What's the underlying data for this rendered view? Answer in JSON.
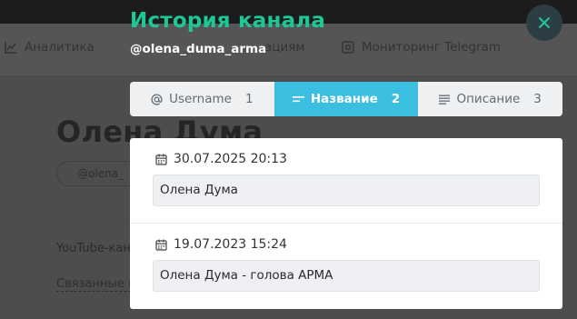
{
  "background": {
    "nav": [
      {
        "label": "Аналитика",
        "icon": "chart-icon"
      },
      {
        "label": "ациям",
        "icon": ""
      },
      {
        "label": "Мониторинг Telegram",
        "icon": "monitor-icon"
      }
    ],
    "channel_name": "Олена Дума",
    "username_pill": "@olena_",
    "youtube_text": "YouTube-кана",
    "related_link": "Связанные к"
  },
  "modal": {
    "title": "История канала",
    "username": "@olena_duma_arma",
    "close_icon": "close-icon",
    "accent_color": "#1ec796",
    "tabs": [
      {
        "label": "Username",
        "count": "1",
        "icon": "at-icon",
        "active": false
      },
      {
        "label": "Название",
        "count": "2",
        "icon": "title-lines-icon",
        "active": true
      },
      {
        "label": "Описание",
        "count": "3",
        "icon": "text-lines-icon",
        "active": false
      }
    ],
    "active_tab_color": "#3bbfe0",
    "entries": [
      {
        "date": "30.07.2025 20:13",
        "value": "Олена Дума"
      },
      {
        "date": "19.07.2023 15:24",
        "value": "Олена Дума - голова АРМА"
      }
    ]
  }
}
